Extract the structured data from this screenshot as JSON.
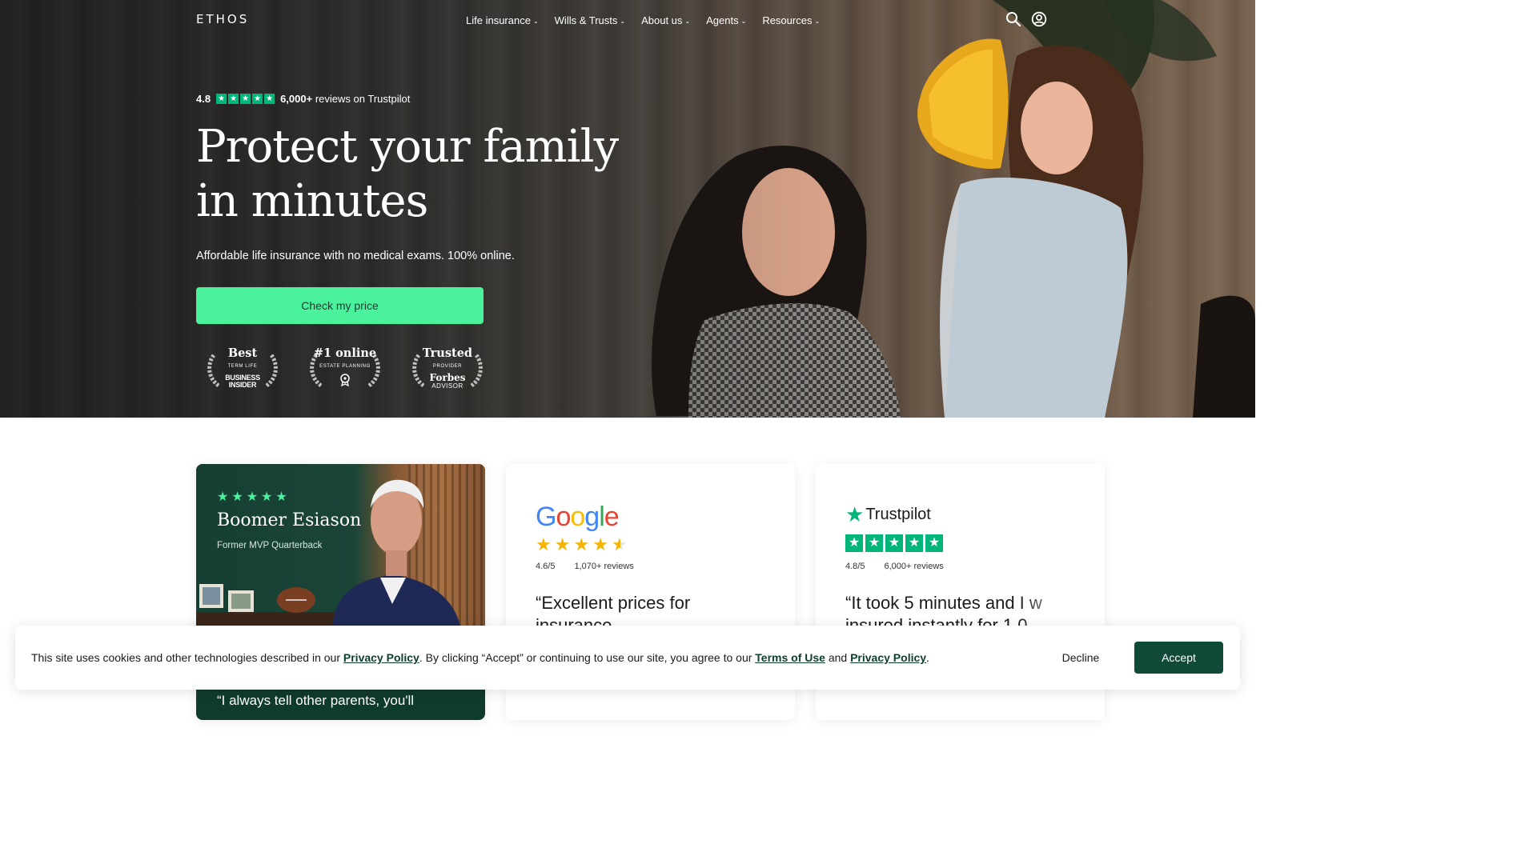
{
  "nav": {
    "logo": "ETHOS",
    "links": [
      "Life insurance",
      "Wills & Trusts",
      "About us",
      "Agents",
      "Resources"
    ],
    "icons": [
      "search-icon",
      "account-icon"
    ]
  },
  "hero": {
    "rating_score": "4.8",
    "rating_count": "6,000+",
    "rating_suffix": "reviews on Trustpilot",
    "headline_line1": "Protect your family",
    "headline_line2": "in minutes",
    "subhead": "Affordable life insurance with no medical exams. 100% online.",
    "cta_label": "Check my price",
    "badges": [
      {
        "title": "Best",
        "sub": "TERM LIFE",
        "brand_line1": "BUSINESS",
        "brand_line2": "INSIDER"
      },
      {
        "title": "#1 online",
        "sub": "ESTATE PLANNING"
      },
      {
        "title": "Trusted",
        "sub": "PROVIDER",
        "brand_line1": "Forbes",
        "brand_line2": "ADVISOR"
      }
    ]
  },
  "cards": {
    "boomer": {
      "name": "Boomer Esiason",
      "role": "Former MVP Quarterback",
      "quote": "“I always tell other parents, you'll"
    },
    "google": {
      "logo": [
        "G",
        "o",
        "o",
        "g",
        "l",
        "e"
      ],
      "rating": "4.6/5",
      "reviews": "1,070+ reviews",
      "quote_line1": "“Excellent prices for",
      "quote_line2": "insurance"
    },
    "trustpilot": {
      "logo": "Trustpilot",
      "rating": "4.8/5",
      "reviews": "6,000+ reviews",
      "quote_line1": "“It took 5 minutes and I w",
      "quote_line2": "insured instantly for 1.0"
    }
  },
  "cookie": {
    "text_1": "This site uses cookies and other technologies described in our ",
    "link_privacy": "Privacy Policy",
    "text_2": ". By clicking “Accept” or continuing to use our site, you agree to our ",
    "link_terms": "Terms of Use",
    "text_3": " and ",
    "link_privacy_2": "Privacy Policy",
    "text_4": ".",
    "decline_label": "Decline",
    "accept_label": "Accept"
  },
  "colors": {
    "cta_green": "#4af29c",
    "dark_green": "#0f4a38",
    "trustpilot_green": "#00b67a",
    "google_star": "#f6b300"
  }
}
